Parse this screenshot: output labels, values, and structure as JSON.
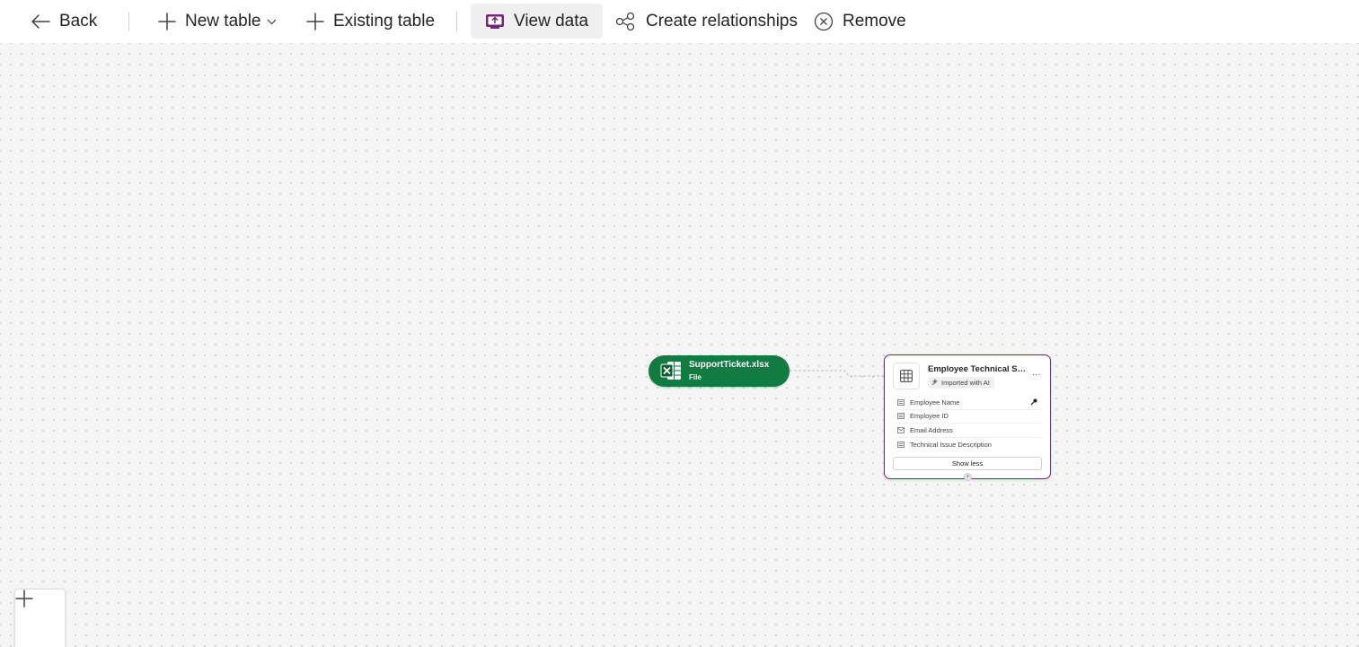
{
  "toolbar": {
    "back": {
      "label": "Back",
      "icon": "arrow-left-icon"
    },
    "new_table": {
      "label": "New table",
      "icon": "plus-icon",
      "chevron": "chevron-down-icon"
    },
    "existing_table": {
      "label": "Existing table",
      "icon": "plus-icon"
    },
    "view_data": {
      "label": "View data",
      "icon": "view-data-icon",
      "active": true
    },
    "create_relationships": {
      "label": "Create relationships",
      "icon": "relationships-icon"
    },
    "remove": {
      "label": "Remove",
      "icon": "circle-x-icon"
    }
  },
  "canvas": {
    "file_node": {
      "name": "SupportTicket.xlsx",
      "type": "File",
      "icon": "excel-icon",
      "color": "#107c41"
    },
    "table_card": {
      "title": "Employee Technical Sup...",
      "badge": "Imported with AI",
      "more": "...",
      "border_color": "#742774",
      "fields": [
        {
          "label": "Employee Name",
          "icon": "text-field-icon",
          "primary_key": true
        },
        {
          "label": "Employee ID",
          "icon": "text-field-icon",
          "primary_key": false
        },
        {
          "label": "Email Address",
          "icon": "email-field-icon",
          "primary_key": false
        },
        {
          "label": "Technical Issue Description",
          "icon": "text-field-icon",
          "primary_key": false
        }
      ],
      "show_less": "Show less"
    },
    "zoom_in": {
      "icon": "plus-icon"
    }
  },
  "colors": {
    "accent": "#742774",
    "excel_green": "#107c41",
    "canvas_bg": "#f5f5f5"
  }
}
